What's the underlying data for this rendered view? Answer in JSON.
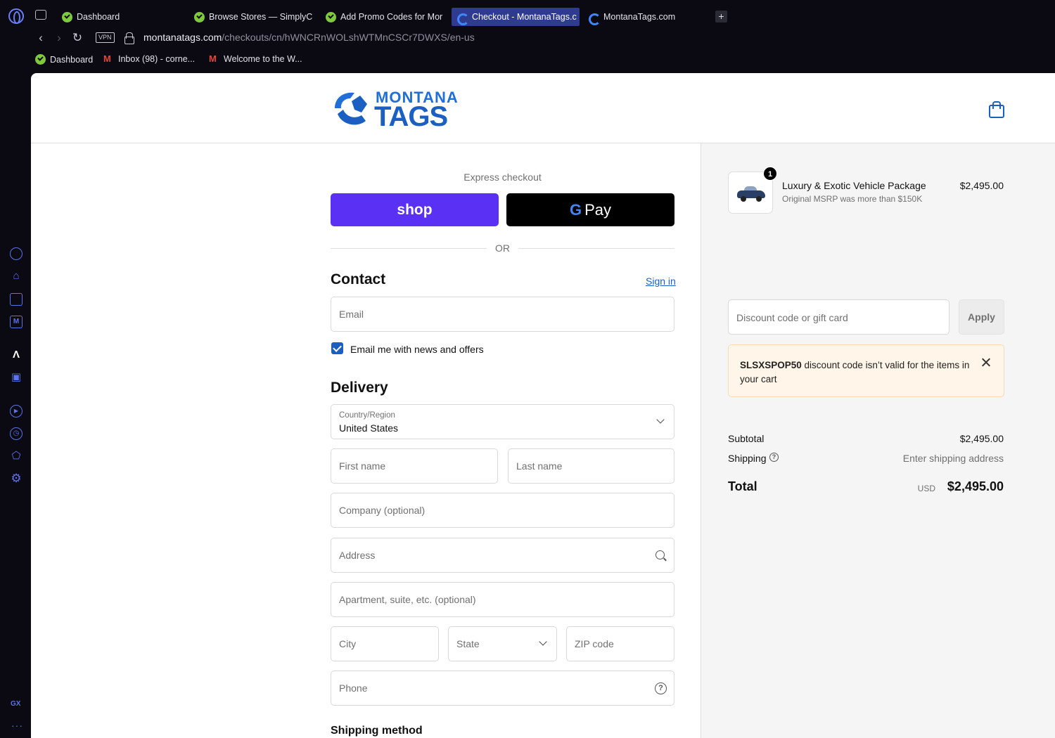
{
  "browser": {
    "tabs": [
      {
        "label": "Dashboard",
        "favicon": "green-check-icon"
      },
      {
        "label": "Browse Stores — SimplyC",
        "favicon": "green-check-icon"
      },
      {
        "label": "Add Promo Codes for Mor",
        "favicon": "green-check-icon"
      },
      {
        "label": "Checkout - MontanaTags.c",
        "favicon": "montana-tags-icon",
        "active": true
      },
      {
        "label": "MontanaTags.com",
        "favicon": "montana-tags-icon"
      }
    ],
    "new_tab": "+",
    "vpn": "VPN",
    "url_host": "montanatags.com",
    "url_path": "/checkouts/cn/hWNCRnWOLshWTMnCSCr7DWXS/en-us",
    "bookmarks": [
      {
        "label": "Dashboard",
        "favicon": "green-check-icon"
      },
      {
        "label": "Inbox (98) - corne...",
        "favicon": "gmail-icon"
      },
      {
        "label": "Welcome to the W...",
        "favicon": "gmail-icon"
      }
    ],
    "sidebar_gx": "GX",
    "sidebar_more": "···"
  },
  "header": {
    "logo_top": "MONTANA",
    "logo_bottom": "TAGS"
  },
  "checkout": {
    "express_title": "Express checkout",
    "shop_pay_label": "shop",
    "gpay_g": "G",
    "gpay_label": "Pay",
    "or_text": "OR",
    "contact_title": "Contact",
    "signin_label": "Sign in",
    "email_placeholder": "Email",
    "news_checkbox_label": "Email me with news and offers",
    "news_checked": true,
    "delivery_title": "Delivery",
    "country_label": "Country/Region",
    "country_value": "United States",
    "first_name_placeholder": "First name",
    "last_name_placeholder": "Last name",
    "company_placeholder": "Company (optional)",
    "address_placeholder": "Address",
    "apartment_placeholder": "Apartment, suite, etc. (optional)",
    "city_placeholder": "City",
    "state_placeholder": "State",
    "zip_placeholder": "ZIP code",
    "phone_placeholder": "Phone",
    "shipping_method_title": "Shipping method"
  },
  "summary": {
    "item": {
      "quantity": "1",
      "name": "Luxury & Exotic Vehicle Package",
      "note": "Original MSRP was more than $150K",
      "price": "$2,495.00"
    },
    "discount_placeholder": "Discount code or gift card",
    "apply_label": "Apply",
    "alert_code": "SLSXSPOP50",
    "alert_message": " discount code isn’t valid for the items in your cart",
    "subtotal_label": "Subtotal",
    "subtotal_value": "$2,495.00",
    "shipping_label": "Shipping",
    "shipping_help": "?",
    "shipping_value": "Enter shipping address",
    "total_label": "Total",
    "total_currency": "USD",
    "total_value": "$2,495.00"
  },
  "colors": {
    "shop_pay": "#5a31f4",
    "brand_blue": "#1b5fc2",
    "alert_bg": "#fff5e8",
    "browser_bg": "#0b0a13",
    "active_tab": "#2f3b8f"
  }
}
